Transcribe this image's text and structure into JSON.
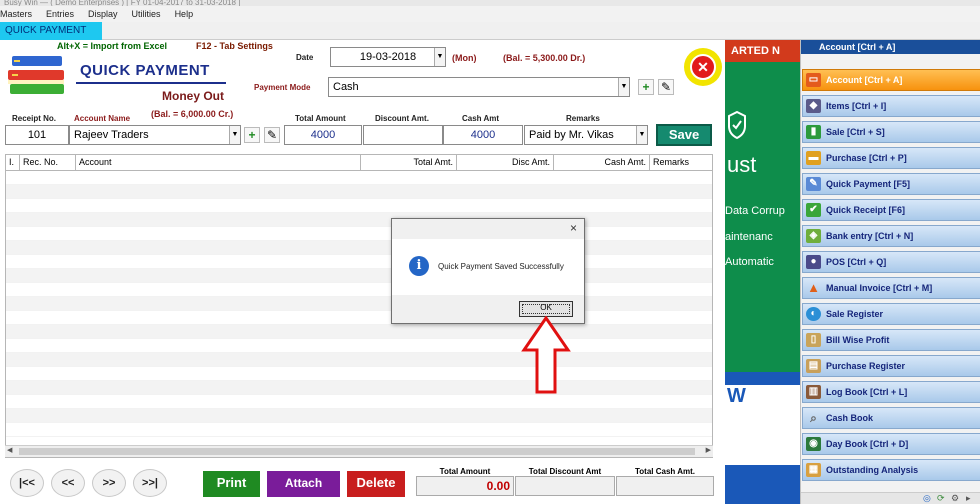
{
  "titlebar": {
    "text": "Busy Win — ( Demo Enterprises ) [ FY 01-04-2017 to 31-03-2018 ]"
  },
  "menu": [
    "Masters",
    "Entries",
    "Display",
    "Utilities",
    "Help"
  ],
  "tab": {
    "label": "QUICK PAYMENT"
  },
  "hints": {
    "import": "Alt+X =  Import from Excel",
    "settings": "F12 - Tab Settings"
  },
  "form": {
    "title": "QUICK PAYMENT",
    "subtitle": "Money Out",
    "account_balance": "(Bal. =    6,000.00 Cr.)",
    "date_label": "Date",
    "date_value": "19-03-2018",
    "day": "(Mon)",
    "date_balance": "(Bal. =    5,300.00 Dr.)",
    "payment_mode_label": "Payment Mode",
    "payment_mode_value": "Cash",
    "receipt_no_label": "Receipt No.",
    "receipt_no_value": "101",
    "account_name_label": "Account Name",
    "account_name_value": "Rajeev Traders",
    "total_amount_label": "Total Amount",
    "total_amount_value": "4000",
    "discount_label": "Discount Amt.",
    "discount_value": "",
    "cash_amt_label": "Cash Amt",
    "cash_amt_value": "4000",
    "remarks_label": "Remarks",
    "remarks_value": "Paid by Mr. Vikas",
    "save_label": "Save"
  },
  "grid": {
    "columns": [
      "I.",
      "Rec. No.",
      "Account",
      "Total Amt.",
      "Disc Amt.",
      "Cash Amt.",
      "Remarks"
    ],
    "rows": []
  },
  "nav": {
    "first": "|<<",
    "prev": "<<",
    "next": ">>",
    "last": ">>|"
  },
  "actions": {
    "print": "Print",
    "attach": "Attach",
    "delete": "Delete"
  },
  "totals": {
    "total_amount_label": "Total Amount",
    "total_amount_value": "0.00",
    "total_discount_label": "Total Discount Amt",
    "total_discount_value": "",
    "total_cash_label": "Total Cash Amt.",
    "total_cash_value": ""
  },
  "background_app": {
    "banner": "ARTED N",
    "line1": "ust",
    "line2": "Data Corrup",
    "line3": "aintenanc",
    "line4": "Automatic",
    "letter": "W"
  },
  "sidebar": {
    "header": "Account [Ctrl + A]",
    "items": [
      {
        "label": "Account [Ctrl + A]",
        "icon": "account-icon",
        "active": true
      },
      {
        "label": "Items [Ctrl + I]",
        "icon": "items-icon"
      },
      {
        "label": "Sale [Ctrl + S]",
        "icon": "sale-icon"
      },
      {
        "label": "Purchase [Ctrl + P]",
        "icon": "purchase-icon"
      },
      {
        "label": "Quick Payment [F5]",
        "icon": "quick-payment-icon"
      },
      {
        "label": "Quick Receipt [F6]",
        "icon": "quick-receipt-icon"
      },
      {
        "label": "Bank entry [Ctrl + N]",
        "icon": "bank-entry-icon"
      },
      {
        "label": "POS [Ctrl + Q]",
        "icon": "pos-icon"
      },
      {
        "label": "Manual Invoice [Ctrl + M]",
        "icon": "manual-invoice-icon"
      },
      {
        "label": "Sale Register",
        "icon": "sale-register-icon"
      },
      {
        "label": "Bill Wise Profit",
        "icon": "bill-wise-profit-icon"
      },
      {
        "label": "Purchase Register",
        "icon": "purchase-register-icon"
      },
      {
        "label": "Log Book [Ctrl + L]",
        "icon": "log-book-icon"
      },
      {
        "label": "Cash Book",
        "icon": "cash-book-icon"
      },
      {
        "label": "Day Book [Ctrl + D]",
        "icon": "day-book-icon"
      },
      {
        "label": "Outstanding Analysis",
        "icon": "outstanding-analysis-icon"
      }
    ]
  },
  "dialog": {
    "message": "Quick Payment Saved Successfully",
    "ok_label": "OK",
    "close": "×"
  },
  "colors": {
    "accent_tab": "#1ec8f0",
    "title_blue": "#1c2f8c",
    "save": "#158a6f",
    "print": "#1f8a22",
    "attach": "#7a1c9a",
    "delete": "#c81e1e",
    "sidebar_active": "#f7920e"
  }
}
